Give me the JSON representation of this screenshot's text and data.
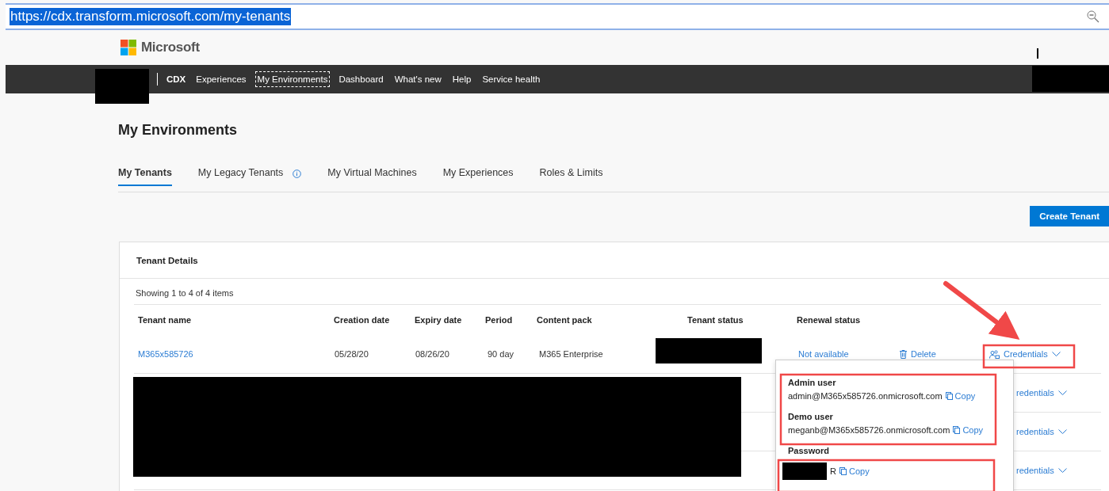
{
  "address_bar": {
    "url": "https://cdx.transform.microsoft.com/my-tenants"
  },
  "header": {
    "logo": "Microsoft"
  },
  "nav": {
    "site_name": "CDX",
    "items": [
      {
        "label": "Experiences",
        "selected": false
      },
      {
        "label": "My Environments",
        "selected": true
      },
      {
        "label": "Dashboard",
        "selected": false
      },
      {
        "label": "What's new",
        "selected": false
      },
      {
        "label": "Help",
        "selected": false
      },
      {
        "label": "Service health",
        "selected": false
      }
    ]
  },
  "page_title": "My Environments",
  "tabs": [
    {
      "label": "My Tenants",
      "selected": true,
      "has_info": false
    },
    {
      "label": "My Legacy Tenants",
      "selected": false,
      "has_info": true
    },
    {
      "label": "My Virtual Machines",
      "selected": false,
      "has_info": false
    },
    {
      "label": "My Experiences",
      "selected": false,
      "has_info": false
    },
    {
      "label": "Roles & Limits",
      "selected": false,
      "has_info": false
    }
  ],
  "create_button": "Create Tenant",
  "card": {
    "title": "Tenant Details",
    "showing": "Showing 1 to 4 of 4 items",
    "columns": [
      "Tenant name",
      "Creation date",
      "Expiry date",
      "Period",
      "Content pack",
      "Tenant status",
      "Renewal status"
    ],
    "rows": [
      {
        "tenant_name": "M365x585726",
        "creation_date": "05/28/20",
        "expiry_date": "08/26/20",
        "period": "90 day",
        "content_pack": "M365 Enterprise",
        "renewal_status": "Not available",
        "delete": "Delete",
        "credentials": "Credentials"
      },
      {
        "credentials": "redentials"
      },
      {
        "credentials": "redentials"
      },
      {
        "credentials": "redentials"
      }
    ]
  },
  "dropdown": {
    "users": [
      {
        "label": "Admin user",
        "value": "admin@M365x585726.onmicrosoft.com",
        "copy": "Copy"
      },
      {
        "label": "Demo user",
        "value": "meganb@M365x585726.onmicrosoft.com",
        "copy": "Copy"
      }
    ],
    "password": {
      "label": "Password",
      "value_tail": "R",
      "copy": "Copy"
    }
  }
}
